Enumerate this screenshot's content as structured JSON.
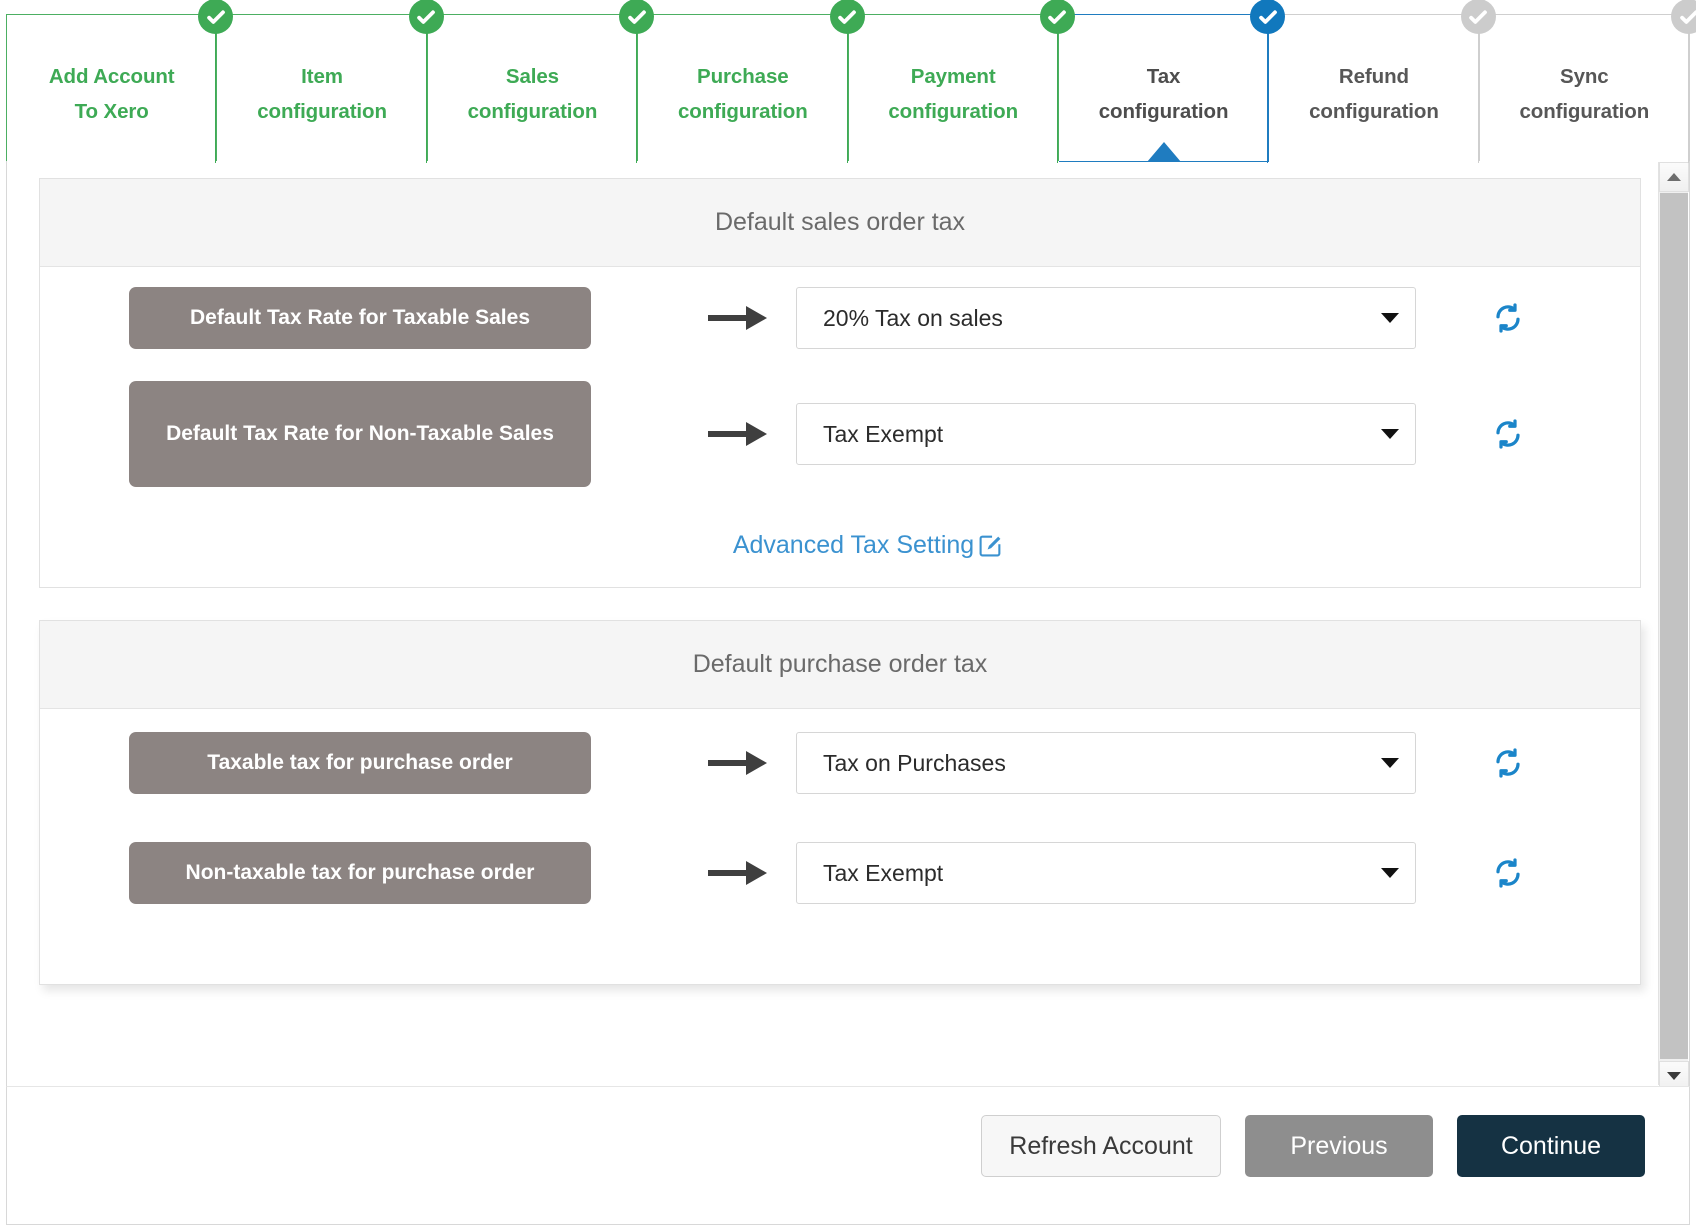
{
  "stepper": {
    "steps": [
      {
        "label": "Add Account\nTo Xero",
        "state": "done",
        "icon": "check-circle-icon"
      },
      {
        "label": "Item\nconfiguration",
        "state": "done",
        "icon": "check-circle-icon"
      },
      {
        "label": "Sales\nconfiguration",
        "state": "done",
        "icon": "check-circle-icon"
      },
      {
        "label": "Purchase\nconfiguration",
        "state": "done",
        "icon": "check-circle-icon"
      },
      {
        "label": "Payment\nconfiguration",
        "state": "done",
        "icon": "check-circle-icon"
      },
      {
        "label": "Tax\nconfiguration",
        "state": "active",
        "icon": "check-circle-icon"
      },
      {
        "label": "Refund\nconfiguration",
        "state": "pending",
        "icon": "check-circle-icon"
      },
      {
        "label": "Sync\nconfiguration",
        "state": "pending",
        "icon": "check-circle-icon"
      }
    ],
    "colors": {
      "done": "#3eaa55",
      "active": "#1178bd",
      "pending": "#cccccc"
    }
  },
  "sales_panel": {
    "title": "Default sales order tax",
    "rows": [
      {
        "tag_label": "Default Tax Rate for Taxable Sales",
        "arrow_icon": "arrow-right-icon",
        "select_value": "20% Tax on sales",
        "caret_icon": "chevron-down-icon",
        "refresh_icon": "refresh-icon"
      },
      {
        "tag_label": "Default Tax Rate for Non-Taxable Sales",
        "arrow_icon": "arrow-right-icon",
        "select_value": "Tax Exempt",
        "caret_icon": "chevron-down-icon",
        "refresh_icon": "refresh-icon"
      }
    ],
    "advanced_link": {
      "label": "Advanced Tax Setting",
      "icon": "pencil-square-icon",
      "color": "#3b92d0"
    }
  },
  "purchase_panel": {
    "title": "Default purchase order tax",
    "rows": [
      {
        "tag_label": "Taxable tax for purchase order",
        "arrow_icon": "arrow-right-icon",
        "select_value": "Tax on Purchases",
        "caret_icon": "chevron-down-icon",
        "refresh_icon": "refresh-icon"
      },
      {
        "tag_label": "Non-taxable tax for purchase order",
        "arrow_icon": "arrow-right-icon",
        "select_value": "Tax Exempt",
        "caret_icon": "chevron-down-icon",
        "refresh_icon": "refresh-icon"
      }
    ]
  },
  "scrollbar": {
    "up_icon": "scroll-up-arrow-icon",
    "down_icon": "scroll-down-arrow-icon"
  },
  "footer": {
    "refresh_account_label": "Refresh Account",
    "previous_label": "Previous",
    "continue_label": "Continue",
    "colors": {
      "continue": "#153243",
      "previous": "#8e8e8e"
    }
  },
  "theme": {
    "tag_background": "#8c8482",
    "panel_header_background": "#f5f5f5",
    "refresh_icon_color": "#1b85c9"
  }
}
